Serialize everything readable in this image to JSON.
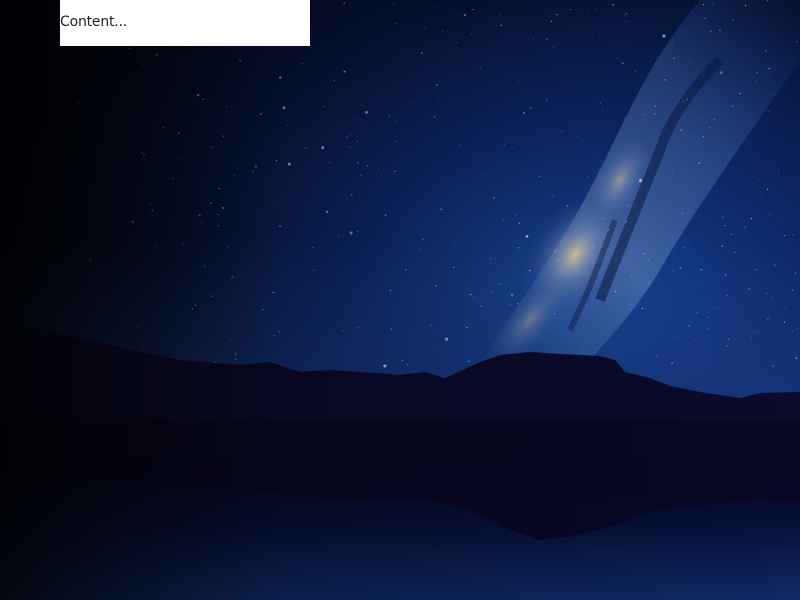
{
  "background": {
    "image": "night-sky-milky-way-mountain-lake",
    "colors": {
      "sky_dark": "#03061a",
      "sky_mid": "#0c2a6b",
      "milky_way_glow": "#d9c9a3",
      "mountain": "#0a0c2e",
      "lake": "#050824"
    }
  },
  "content_box": {
    "text": "Content..."
  }
}
